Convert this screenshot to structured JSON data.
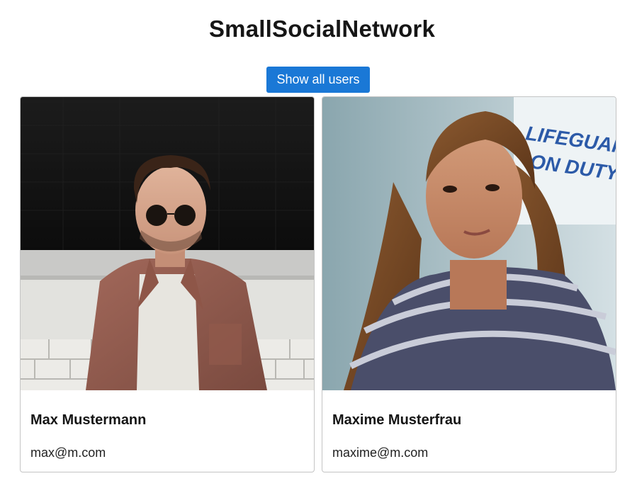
{
  "header": {
    "title": "SmallSocialNetwork"
  },
  "actions": {
    "show_all_label": "Show all users"
  },
  "users": [
    {
      "name": "Max Mustermann",
      "email": "max@m.com",
      "photo_icon": "man-portrait-photo"
    },
    {
      "name": "Maxime Musterfrau",
      "email": "maxime@m.com",
      "photo_icon": "woman-portrait-photo",
      "photo_sign_lines": [
        "LIFEGUARD",
        "ON DUTY"
      ]
    }
  ],
  "colors": {
    "accent": "#1a78d6",
    "card_border": "#c4c4c4"
  }
}
